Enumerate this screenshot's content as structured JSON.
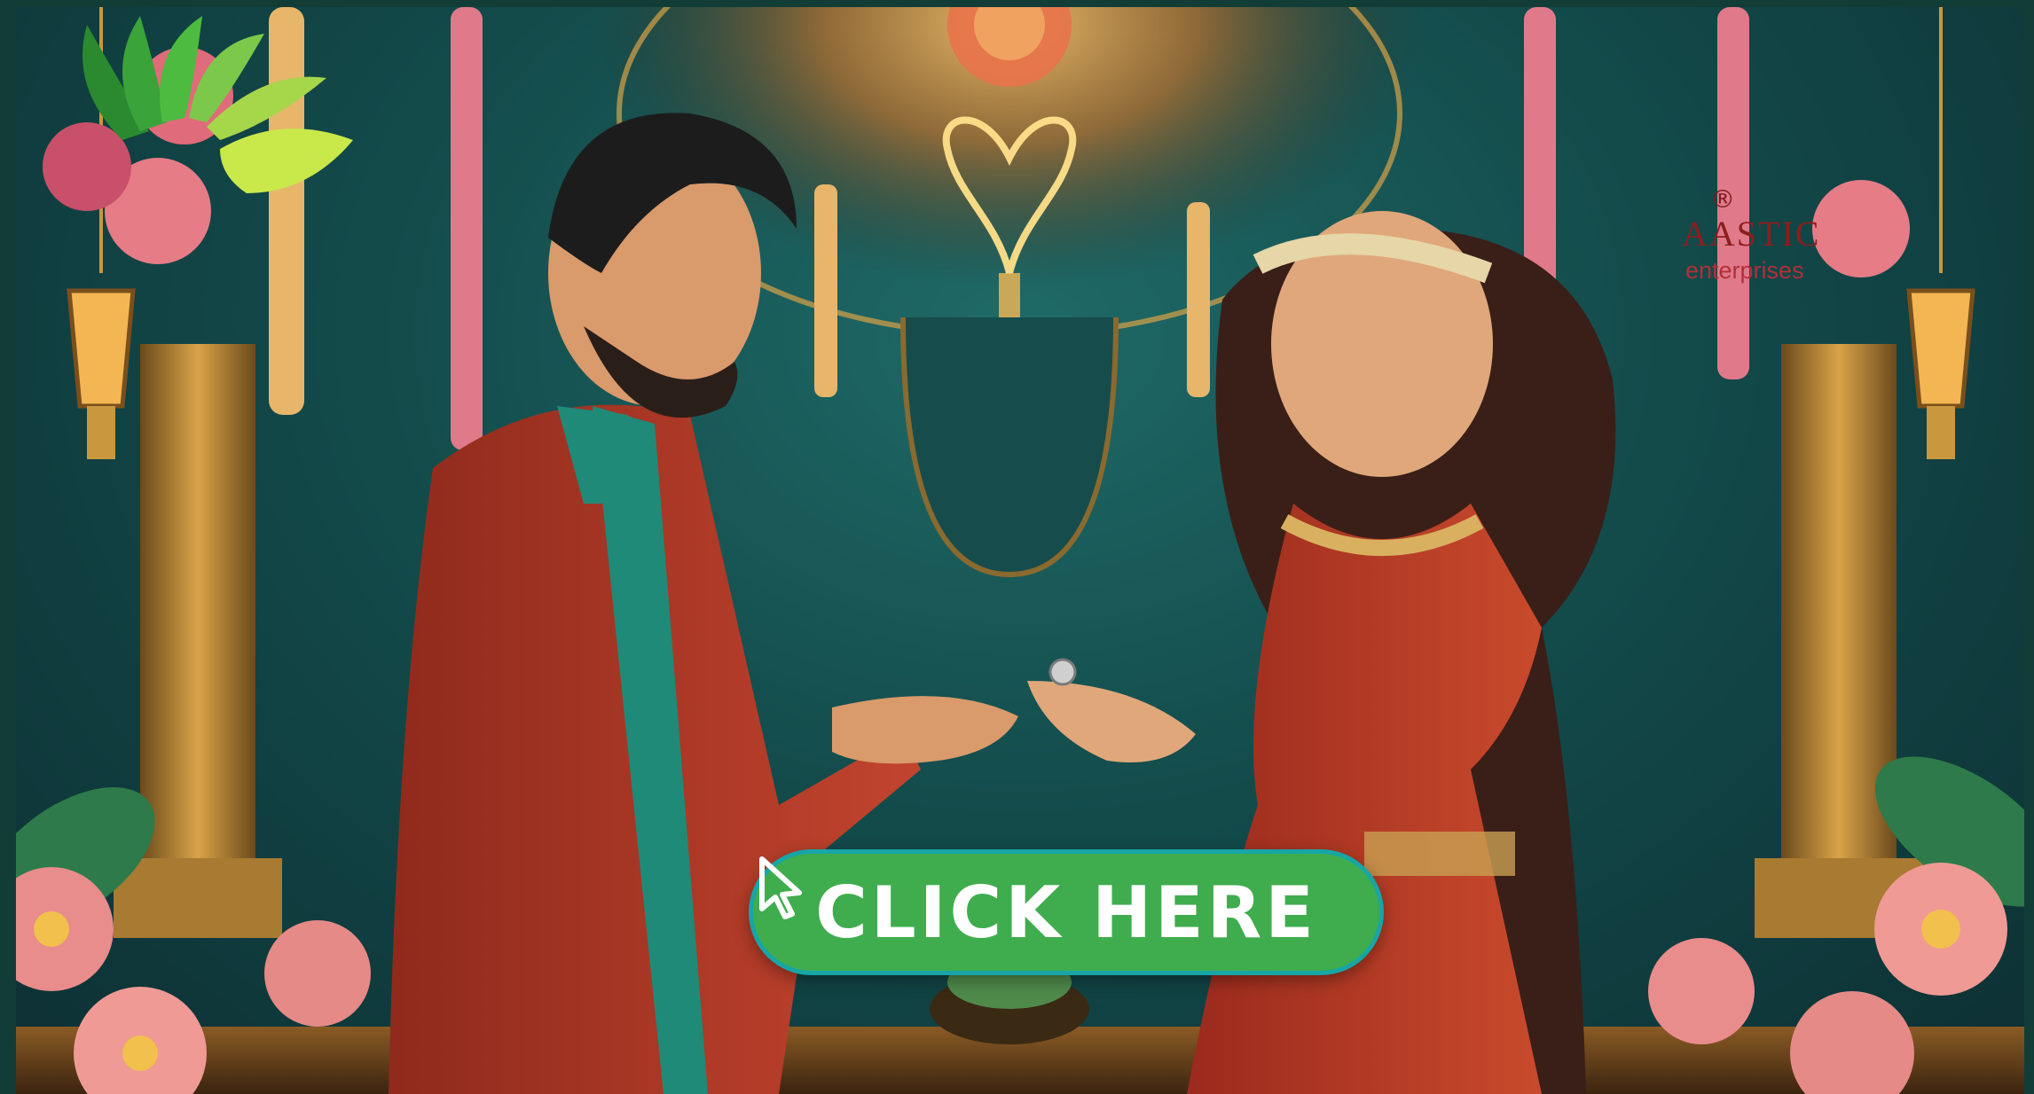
{
  "cta": {
    "label": "CLICK HERE",
    "icon": "cursor-arrow-icon",
    "color": "#3fad4e",
    "border_color": "#17a5a6"
  },
  "logo": {
    "registered_mark": "®",
    "brand": "AASTIC",
    "sub": "enterprises",
    "icon": "leaf-fan-logo"
  },
  "illustration": {
    "scene": "couple-ring-ceremony",
    "palette": {
      "teal": "#134b4b",
      "red": "#b53424",
      "gold": "#d9a347",
      "green": "#3fad4e"
    }
  }
}
